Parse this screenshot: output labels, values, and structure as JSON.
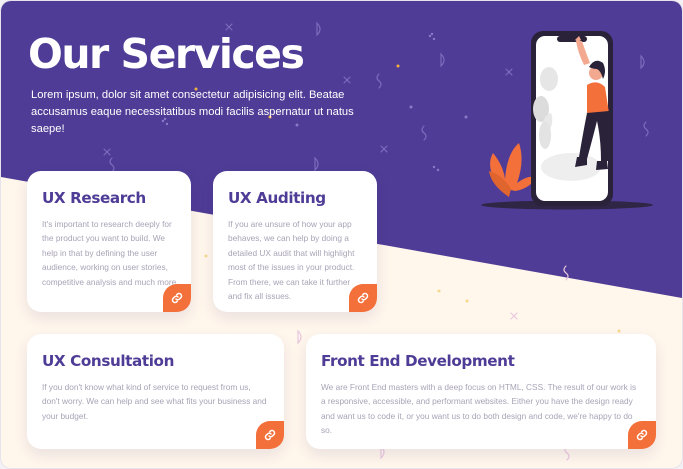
{
  "hero": {
    "title": "Our Services",
    "subtitle": "Lorem ipsum, dolor sit amet consectetur adipisicing elit. Beatae accusamus eaque necessitatibus modi facilis aspernatur ut natus saepe!"
  },
  "colors": {
    "purple": "#4f3c96",
    "orange": "#f3703a",
    "cream": "#fff6ec"
  },
  "services": [
    {
      "title": "UX Research",
      "description": "It's important to research deeply for the product you want to build. We help in that by defining the user audience, working on user stories, competitive analysis and much more.",
      "icon": "link-icon"
    },
    {
      "title": "UX Auditing",
      "description": "If you are unsure of how your app behaves, we can help by doing a detailed UX audit that will highlight most of the issues in your product. From there, we can take it further and fix all issues.",
      "icon": "link-icon"
    },
    {
      "title": "UX Consultation",
      "description": "If you don't know what kind of service to request from us, don't worry. We can help and see what fits your business and your budget.",
      "icon": "link-icon"
    },
    {
      "title": "Front End Development",
      "description": "We are Front End masters with a deep focus on HTML, CSS. The result of our work is a responsive, accessible, and performant websites. Either you have the design ready and want us to code it, or you want us to do both design and code, we're happy to do so.",
      "icon": "link-icon"
    }
  ]
}
